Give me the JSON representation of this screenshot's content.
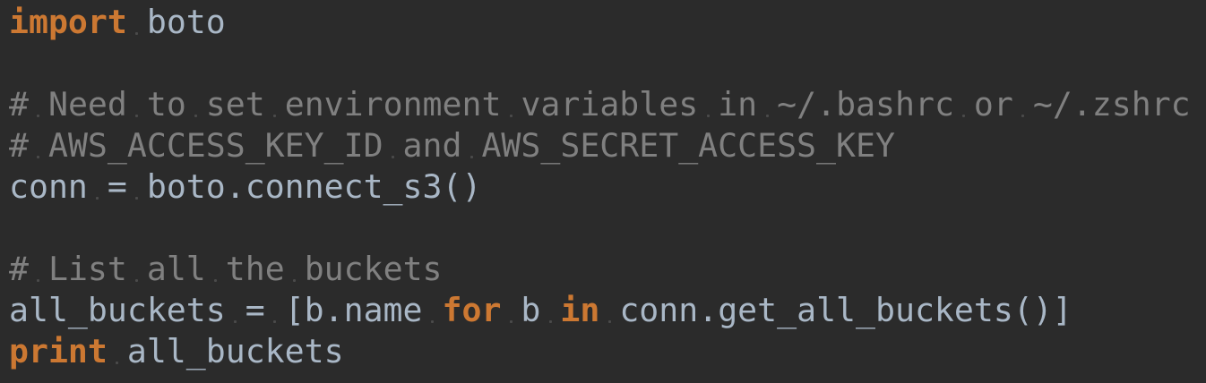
{
  "colors": {
    "background": "#2b2b2b",
    "default_text": "#a9b7c6",
    "keyword": "#cc7832",
    "comment": "#808080",
    "whitespace_marker": "#4a4a4a"
  },
  "lines": [
    [
      {
        "t": "import",
        "c": "kw"
      },
      {
        "t": " ",
        "c": "ws"
      },
      {
        "t": "boto",
        "c": "tx"
      }
    ],
    [],
    [
      {
        "t": "#",
        "c": "cm"
      },
      {
        "t": " ",
        "c": "ws"
      },
      {
        "t": "Need",
        "c": "cm"
      },
      {
        "t": " ",
        "c": "ws"
      },
      {
        "t": "to",
        "c": "cm"
      },
      {
        "t": " ",
        "c": "ws"
      },
      {
        "t": "set",
        "c": "cm"
      },
      {
        "t": " ",
        "c": "ws"
      },
      {
        "t": "environment",
        "c": "cm"
      },
      {
        "t": " ",
        "c": "ws"
      },
      {
        "t": "variables",
        "c": "cm"
      },
      {
        "t": " ",
        "c": "ws"
      },
      {
        "t": "in",
        "c": "cm"
      },
      {
        "t": " ",
        "c": "ws"
      },
      {
        "t": "~/.bashrc",
        "c": "cm"
      },
      {
        "t": " ",
        "c": "ws"
      },
      {
        "t": "or",
        "c": "cm"
      },
      {
        "t": " ",
        "c": "ws"
      },
      {
        "t": "~/.zshrc",
        "c": "cm"
      }
    ],
    [
      {
        "t": "#",
        "c": "cm"
      },
      {
        "t": " ",
        "c": "ws"
      },
      {
        "t": "AWS_ACCESS_KEY_ID",
        "c": "cm"
      },
      {
        "t": " ",
        "c": "ws"
      },
      {
        "t": "and",
        "c": "cm"
      },
      {
        "t": " ",
        "c": "ws"
      },
      {
        "t": "AWS_SECRET_ACCESS_KEY",
        "c": "cm"
      }
    ],
    [
      {
        "t": "conn",
        "c": "tx"
      },
      {
        "t": " ",
        "c": "ws"
      },
      {
        "t": "=",
        "c": "tx"
      },
      {
        "t": " ",
        "c": "ws"
      },
      {
        "t": "boto.connect_s3()",
        "c": "tx"
      }
    ],
    [],
    [
      {
        "t": "#",
        "c": "cm"
      },
      {
        "t": " ",
        "c": "ws"
      },
      {
        "t": "List",
        "c": "cm"
      },
      {
        "t": " ",
        "c": "ws"
      },
      {
        "t": "all",
        "c": "cm"
      },
      {
        "t": " ",
        "c": "ws"
      },
      {
        "t": "the",
        "c": "cm"
      },
      {
        "t": " ",
        "c": "ws"
      },
      {
        "t": "buckets",
        "c": "cm"
      }
    ],
    [
      {
        "t": "all_buckets",
        "c": "tx"
      },
      {
        "t": " ",
        "c": "ws"
      },
      {
        "t": "=",
        "c": "tx"
      },
      {
        "t": " ",
        "c": "ws"
      },
      {
        "t": "[b.name",
        "c": "tx"
      },
      {
        "t": " ",
        "c": "ws"
      },
      {
        "t": "for",
        "c": "kw"
      },
      {
        "t": " ",
        "c": "ws"
      },
      {
        "t": "b",
        "c": "tx"
      },
      {
        "t": " ",
        "c": "ws"
      },
      {
        "t": "in",
        "c": "kw"
      },
      {
        "t": " ",
        "c": "ws"
      },
      {
        "t": "conn.get_all_buckets()]",
        "c": "tx"
      }
    ],
    [
      {
        "t": "print",
        "c": "kw"
      },
      {
        "t": " ",
        "c": "ws"
      },
      {
        "t": "all_buckets",
        "c": "tx"
      }
    ]
  ]
}
